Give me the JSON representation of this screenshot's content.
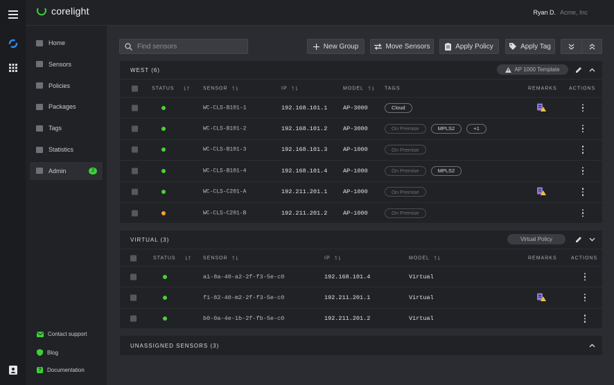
{
  "app": {
    "logo_text": "corelight",
    "user_name": "Ryan D.",
    "user_org": "Acme, Inc"
  },
  "nav": [
    {
      "label": "Home",
      "icon": "home-icon"
    },
    {
      "label": "Sensors",
      "icon": "sensors-icon"
    },
    {
      "label": "Policies",
      "icon": "policies-icon"
    },
    {
      "label": "Packages",
      "icon": "packages-icon"
    },
    {
      "label": "Tags",
      "icon": "tags-icon"
    },
    {
      "label": "Statistics",
      "icon": "statistics-icon"
    },
    {
      "label": "Admin",
      "icon": "gear-icon",
      "badge": "2",
      "active": true
    }
  ],
  "footer_links": [
    "Contact support",
    "Blog",
    "Documentation"
  ],
  "toolbar": {
    "search_placeholder": "Find sensors",
    "new_group": "New Group",
    "move_sensors": "Move Sensors",
    "apply_policy": "Apply Policy",
    "apply_tag": "Apply Tag"
  },
  "columns": {
    "status": "STATUS",
    "sensor": "SENSOR",
    "ip": "IP",
    "model": "MODEL",
    "tags": "TAGS",
    "remarks": "REMARKS",
    "actions": "ACTIONS"
  },
  "groups": {
    "west": {
      "title": "WEST (6)",
      "policy": "AP 1000 Template",
      "rows": [
        {
          "status": "online",
          "sensor": "WC-CLS-B101-1",
          "ip": "192.168.101.1",
          "model": "AP-3000",
          "tags": [
            {
              "label": "Cloud",
              "style": "normal"
            }
          ],
          "remark": true
        },
        {
          "status": "online",
          "sensor": "WC-CLS-B101-2",
          "ip": "192.168.101.2",
          "model": "AP-3000",
          "tags": [
            {
              "label": "On Premise",
              "style": "dim"
            },
            {
              "label": "MPLS2",
              "style": "normal"
            },
            {
              "label": "+1",
              "style": "normal"
            }
          ],
          "remark": false
        },
        {
          "status": "online",
          "sensor": "WC-CLS-B101-3",
          "ip": "192.168.101.3",
          "model": "AP-1000",
          "tags": [
            {
              "label": "On Premise",
              "style": "dim"
            }
          ],
          "remark": false
        },
        {
          "status": "online",
          "sensor": "WC-CLS-B101-4",
          "ip": "192.168.101.4",
          "model": "AP-1000",
          "tags": [
            {
              "label": "On Premise",
              "style": "dim"
            },
            {
              "label": "MPLS2",
              "style": "normal"
            }
          ],
          "remark": false
        },
        {
          "status": "online",
          "sensor": "WC-CLS-C201-A",
          "ip": "192.211.201.1",
          "model": "AP-1000",
          "tags": [
            {
              "label": "On Premise",
              "style": "dim"
            }
          ],
          "remark": true
        },
        {
          "status": "warning",
          "sensor": "WC-CLS-C201-B",
          "ip": "192.211.201.2",
          "model": "AP-1000",
          "tags": [
            {
              "label": "On Premise",
              "style": "dim"
            }
          ],
          "remark": false
        }
      ]
    },
    "virtual": {
      "title": "VIRTUAL (3)",
      "policy": "Virtual Policy",
      "rows": [
        {
          "status": "online",
          "sensor": "a1-8a-40-a2-2f-f3-5e-c0",
          "ip": "192.168.101.4",
          "model": "Virtual",
          "remark": false
        },
        {
          "status": "online",
          "sensor": "f1-82-40-m2-2f-f3-5e-c0",
          "ip": "192.211.201.1",
          "model": "Virtual",
          "remark": true
        },
        {
          "status": "online",
          "sensor": "b0-0a-4e-1b-2f-fb-5e-c0",
          "ip": "192.211.201.2",
          "model": "Virtual",
          "remark": false
        }
      ]
    },
    "unassigned": {
      "title": "UNASSIGNED SENSORS (3)"
    }
  },
  "colors": {
    "online": "#4cd137",
    "warning": "#f0a32a",
    "accent": "#3ecf3a",
    "remark_icon": "#8b7bd8",
    "remark_warn": "#f0c23a"
  }
}
